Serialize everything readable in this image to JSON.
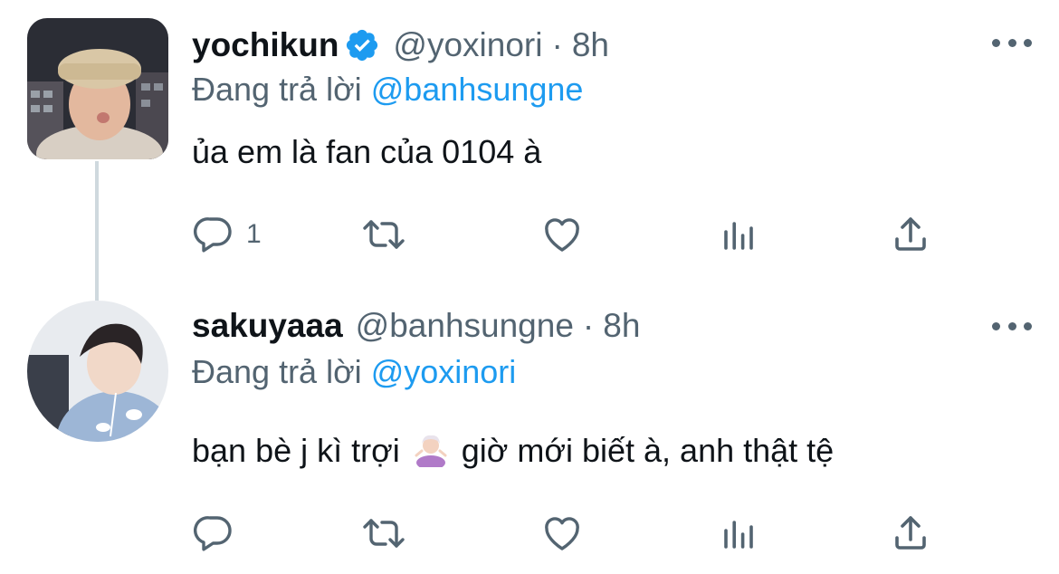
{
  "tweets": [
    {
      "name": "yochikun",
      "handle": "@yoxinori",
      "separator": "·",
      "time": "8h",
      "reply_prefix": "Đang trả lời",
      "reply_mention": "@banhsungne",
      "text": "ủa em là fan của 0104 à",
      "reply_count": "1",
      "verified": true,
      "avatar_icon": "avatar-photo"
    },
    {
      "name": "sakuyaaa",
      "handle": "@banhsungne",
      "separator": "·",
      "time": "8h",
      "reply_prefix": "Đang trả lời",
      "reply_mention": "@yoxinori",
      "text_before": "bạn bè j kì trợi",
      "text_emoji": "person-shrugging-emoji",
      "text_after": "giờ mới biết à, anh thật tệ",
      "reply_count": "",
      "verified": false,
      "avatar_icon": "avatar-photo"
    }
  ],
  "colors": {
    "text_primary": "#0f1419",
    "text_secondary": "#536471",
    "link": "#1d9bf0",
    "thread_line": "#cfd9de",
    "verified_badge": "#1d9bf0"
  },
  "icons": [
    "reply-icon",
    "retweet-icon",
    "like-icon",
    "analytics-icon",
    "share-icon",
    "more-icon",
    "verified-icon"
  ]
}
